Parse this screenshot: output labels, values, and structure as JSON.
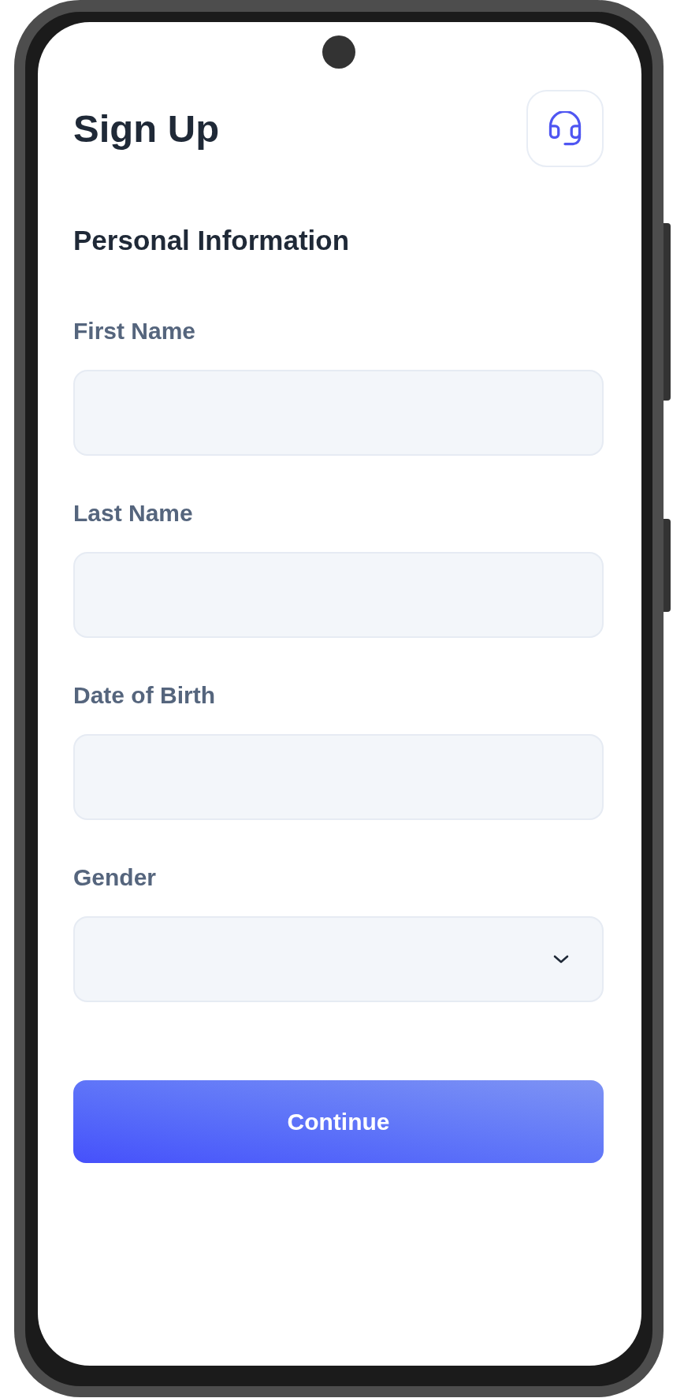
{
  "title": "Sign Up",
  "section_title": "Personal Information",
  "fields": [
    {
      "kind": "text",
      "label": "First Name"
    },
    {
      "kind": "text",
      "label": "Last Name"
    },
    {
      "kind": "text",
      "label": "Date of Birth"
    },
    {
      "kind": "select",
      "label": "Gender"
    }
  ],
  "primary_button": "Continue"
}
